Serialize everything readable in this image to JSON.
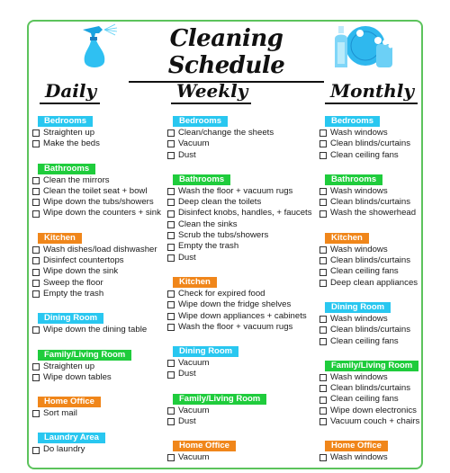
{
  "title": "Cleaning Schedule",
  "icons": {
    "left": "spray-bottle-icon",
    "right": "dish-soap-icon"
  },
  "colors": {
    "border": "#5cc35c",
    "cyan": "#29c7f0",
    "green": "#1fcc3c",
    "orange": "#f0861a"
  },
  "columns": [
    {
      "heading": "Daily",
      "sections": [
        {
          "label": "Bedrooms",
          "color": "cyan",
          "items": [
            "Straighten up",
            "Make the beds"
          ]
        },
        {
          "label": "Bathrooms",
          "color": "green",
          "items": [
            "Clean the mirrors",
            "Clean the toilet seat + bowl",
            "Wipe down the tubs/showers",
            "Wipe down the counters + sink"
          ]
        },
        {
          "label": "Kitchen",
          "color": "orange",
          "items": [
            "Wash dishes/load dishwasher",
            "Disinfect countertops",
            "Wipe down the sink",
            "Sweep the floor",
            "Empty the trash"
          ]
        },
        {
          "label": "Dining Room",
          "color": "cyan",
          "items": [
            "Wipe down the dining table"
          ]
        },
        {
          "label": "Family/Living Room",
          "color": "green",
          "items": [
            "Straighten up",
            "Wipe down tables"
          ]
        },
        {
          "label": "Home Office",
          "color": "orange",
          "items": [
            "Sort mail"
          ]
        },
        {
          "label": "Laundry Area",
          "color": "cyan",
          "items": [
            "Do laundry"
          ]
        }
      ]
    },
    {
      "heading": "Weekly",
      "sections": [
        {
          "label": "Bedrooms",
          "color": "cyan",
          "items": [
            "Clean/change the sheets",
            "Vacuum",
            "Dust"
          ]
        },
        {
          "label": "Bathrooms",
          "color": "green",
          "items": [
            "Wash the floor + vacuum rugs",
            "Deep clean the toilets",
            "Disinfect knobs, handles, + faucets",
            "Clean the sinks",
            "Scrub the tubs/showers",
            "Empty the trash",
            "Dust"
          ]
        },
        {
          "label": "Kitchen",
          "color": "orange",
          "items": [
            "Check for expired food",
            "Wipe down the fridge shelves",
            "Wipe down appliances + cabinets",
            "Wash the floor + vacuum rugs"
          ]
        },
        {
          "label": "Dining Room",
          "color": "cyan",
          "items": [
            "Vacuum",
            "Dust"
          ]
        },
        {
          "label": "Family/Living Room",
          "color": "green",
          "items": [
            "Vacuum",
            "Dust"
          ]
        },
        {
          "label": "Home Office",
          "color": "orange",
          "items": [
            "Vacuum"
          ]
        }
      ]
    },
    {
      "heading": "Monthly",
      "sections": [
        {
          "label": "Bedrooms",
          "color": "cyan",
          "items": [
            "Wash windows",
            "Clean blinds/curtains",
            "Clean ceiling fans"
          ]
        },
        {
          "label": "Bathrooms",
          "color": "green",
          "items": [
            "Wash windows",
            "Clean blinds/curtains",
            "Wash the showerhead"
          ]
        },
        {
          "label": "Kitchen",
          "color": "orange",
          "items": [
            "Wash windows",
            "Clean blinds/curtains",
            "Clean ceiling fans",
            "Deep clean appliances"
          ]
        },
        {
          "label": "Dining Room",
          "color": "cyan",
          "items": [
            "Wash windows",
            "Clean blinds/curtains",
            "Clean ceiling fans"
          ]
        },
        {
          "label": "Family/Living Room",
          "color": "green",
          "items": [
            "Wash windows",
            "Clean blinds/curtains",
            "Clean ceiling fans",
            "Wipe down electronics",
            "Vacuum couch + chairs"
          ]
        },
        {
          "label": "Home Office",
          "color": "orange",
          "items": [
            "Wash windows"
          ]
        }
      ]
    }
  ]
}
